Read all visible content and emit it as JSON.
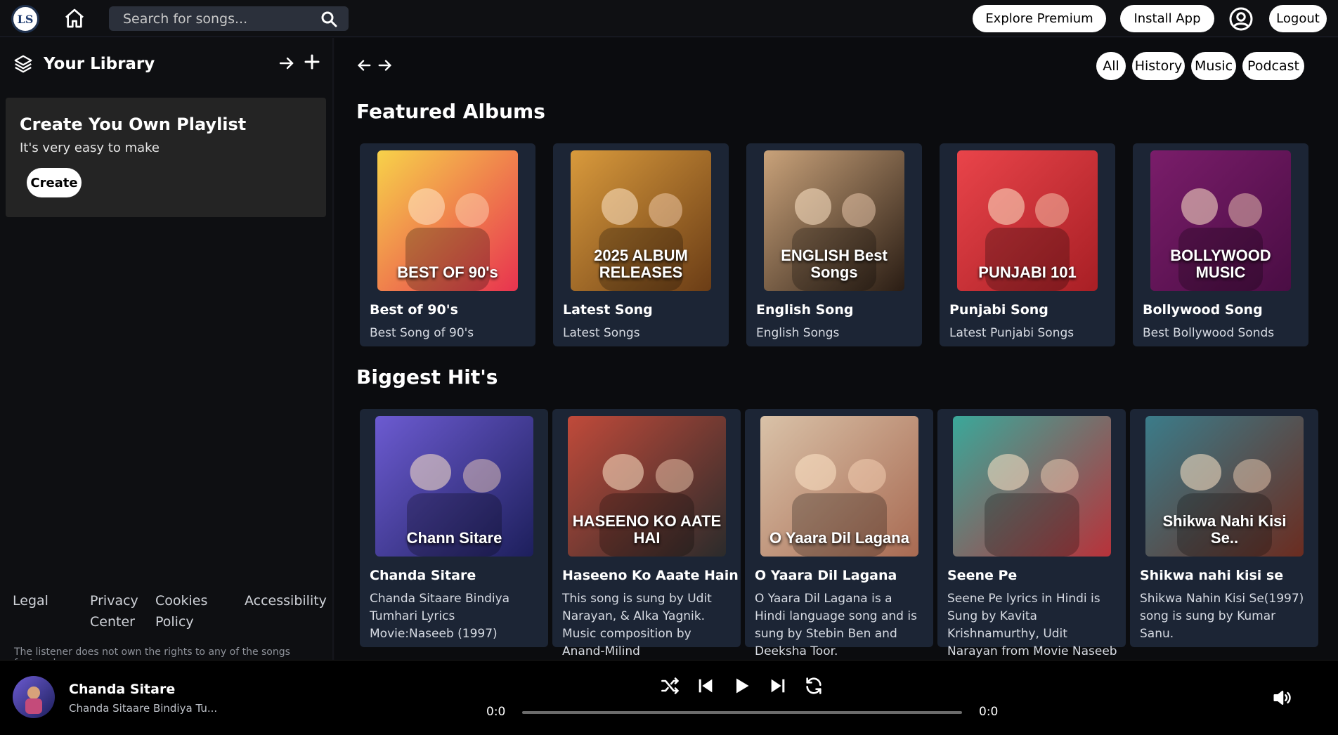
{
  "header": {
    "logo_text": "LS",
    "search_placeholder": "Search for songs...",
    "explore_premium": "Explore Premium",
    "install_app": "Install App",
    "logout": "Logout"
  },
  "sidebar": {
    "library_title": "Your Library",
    "create_card": {
      "title": "Create You Own Playlist",
      "subtitle": "It's very easy to make",
      "button": "Create"
    },
    "footer_links": [
      "Legal",
      "Privacy Center",
      "Cookies Policy",
      "Accessibility"
    ],
    "disclaimer": "The listener does not own the rights to any of the songs featured."
  },
  "main": {
    "filters": [
      "All",
      "History",
      "Music",
      "Podcast"
    ],
    "featured_title": "Featured Albums",
    "featured": [
      {
        "title": "Best of 90's",
        "desc": "Best Song of 90's",
        "art_text": "BEST OF 90's",
        "color1": "#f7d24a",
        "color2": "#e8334f"
      },
      {
        "title": "Latest Song",
        "desc": "Latest Songs",
        "art_text": "2025 ALBUM RELEASES",
        "color1": "#d99a3c",
        "color2": "#6b3d16"
      },
      {
        "title": "English Song",
        "desc": "English Songs",
        "art_text": "ENGLISH Best Songs",
        "color1": "#c9a27a",
        "color2": "#2a1d14"
      },
      {
        "title": "Punjabi Song",
        "desc": "Latest Punjabi Songs",
        "art_text": "PUNJABI 101",
        "color1": "#e9444a",
        "color2": "#a81f25"
      },
      {
        "title": "Bollywood Song",
        "desc": "Best Bollywood Sonds",
        "art_text": "BOLLYWOOD MUSIC",
        "color1": "#7a1d6a",
        "color2": "#4a0d44"
      }
    ],
    "hits_title": "Biggest Hit's",
    "hits": [
      {
        "title": "Chanda Sitare",
        "desc": "Chanda Sitaare Bindiya Tumhari Lyrics Movie:Naseeb (1997)",
        "art_text": "Chann Sitare",
        "color1": "#6c5bd1",
        "color2": "#1d1f5c"
      },
      {
        "title": "Haseeno Ko Aaate Hain",
        "desc": "This song is sung by Udit Narayan, & Alka Yagnik. Music composition by Anand-Milind",
        "art_text": "HASEENO KO AATE HAI",
        "color1": "#c04a3a",
        "color2": "#2b2b2b"
      },
      {
        "title": "O Yaara Dil Lagana",
        "desc": "O Yaara Dil Lagana is a Hindi language song and is sung by Stebin Ben and Deeksha Toor.",
        "art_text": "O Yaara Dil Lagana",
        "color1": "#d9c2a8",
        "color2": "#a86a52"
      },
      {
        "title": "Seene Pe",
        "desc": "Seene Pe lyrics in Hindi is Sung by Kavita Krishnamurthy, Udit Narayan from Movie Naseeb",
        "art_text": "",
        "color1": "#3aa89a",
        "color2": "#b8323a"
      },
      {
        "title": "Shikwa nahi kisi se",
        "desc": "Shikwa Nahin Kisi Se(1997) song is sung by Kumar Sanu.",
        "art_text": "Shikwa Nahi Kisi Se..",
        "color1": "#3b7c8a",
        "color2": "#6b2c20"
      }
    ]
  },
  "player": {
    "title": "Chanda Sitare",
    "subtitle": "Chanda Sitaare Bindiya Tu...",
    "time_current": "0:0",
    "time_total": "0:0",
    "progress": 0
  }
}
